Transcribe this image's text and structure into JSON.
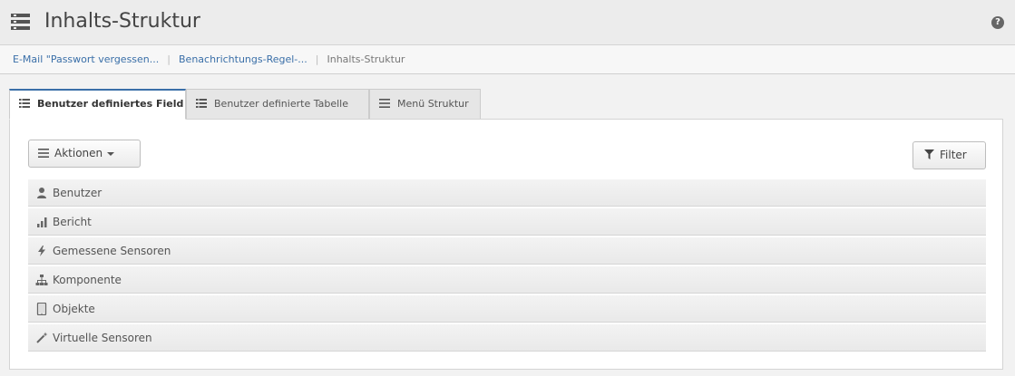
{
  "header": {
    "title": "Inhalts-Struktur",
    "title_icon": "list-table-icon",
    "help_icon": "question-circle-icon",
    "help_glyph": "?"
  },
  "breadcrumb": {
    "items": [
      "E-Mail \"Passwort vergessen...",
      "Benachrichtungs-Regel-...",
      "Inhalts-Struktur"
    ],
    "separator": "|"
  },
  "tabs": [
    {
      "label": "Benutzer definiertes Field",
      "icon": "table-icon",
      "active": true
    },
    {
      "label": "Benutzer definierte Tabelle",
      "icon": "table-icon",
      "active": false
    },
    {
      "label": "Menü Struktur",
      "icon": "menu-lines-icon",
      "active": false
    }
  ],
  "toolbar": {
    "actions_label": "Aktionen",
    "filter_label": "Filter"
  },
  "list": {
    "items": [
      {
        "label": "Benutzer",
        "icon": "user-icon"
      },
      {
        "label": "Bericht",
        "icon": "bar-chart-icon"
      },
      {
        "label": "Gemessene Sensoren",
        "icon": "bolt-icon"
      },
      {
        "label": "Komponente",
        "icon": "sitemap-icon"
      },
      {
        "label": "Objekte",
        "icon": "tablet-icon"
      },
      {
        "label": "Virtuelle Sensoren",
        "icon": "magic-wand-icon"
      }
    ]
  },
  "colors": {
    "accent": "#3a6fa8",
    "header_bg": "#ececec",
    "row_bg": "#efefef"
  }
}
